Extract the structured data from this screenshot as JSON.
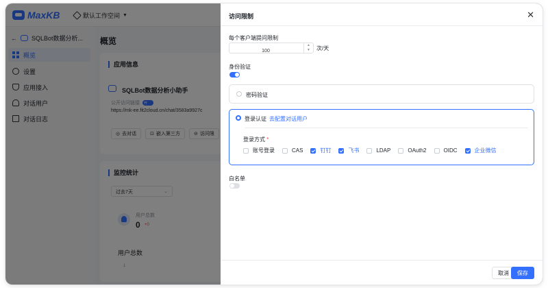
{
  "topbar": {
    "logo": "MaxKB",
    "workspace": "默认工作空间"
  },
  "sidebar": {
    "app_title": "SQLBot数据分析...",
    "items": [
      {
        "label": "概览",
        "icon": "grid-icon",
        "active": true
      },
      {
        "label": "设置",
        "icon": "gear-icon",
        "active": false
      },
      {
        "label": "应用接入",
        "icon": "shield-icon",
        "active": false
      },
      {
        "label": "对话用户",
        "icon": "user-icon",
        "active": false
      },
      {
        "label": "对话日志",
        "icon": "document-icon",
        "active": false
      }
    ]
  },
  "main": {
    "title": "概览",
    "app_info": {
      "heading": "应用信息",
      "app_name": "SQLBot数据分析小助手",
      "public_link_label": "公开访问链接",
      "public_toggle": "开",
      "url": "https://mk-ee.fit2cloud.cn/chat/3583a9927c",
      "buttons": [
        "去对话",
        "嵌入第三方",
        "访问限"
      ]
    },
    "monitor": {
      "heading": "监控统计",
      "range": "过去7天",
      "stat_label": "用户总数",
      "stat_value": "0",
      "stat_delta": "+0",
      "chart_title": "用户总数",
      "axis_tick": "1"
    }
  },
  "drawer": {
    "title": "访问限制",
    "per_client_limit_label": "每个客户端提问限制",
    "per_client_limit_value": "100",
    "per_client_limit_unit": "次/天",
    "auth_label": "身份验证",
    "auth_enabled": true,
    "password_option": "密码验证",
    "login_option": "登录认证",
    "login_link": "去配置对话用户",
    "login_methods_label": "登录方式",
    "required_mark": "*",
    "login_methods": [
      {
        "label": "账号登录",
        "checked": false
      },
      {
        "label": "CAS",
        "checked": false
      },
      {
        "label": "钉钉",
        "checked": true
      },
      {
        "label": "飞书",
        "checked": true
      },
      {
        "label": "LDAP",
        "checked": false
      },
      {
        "label": "OAuth2",
        "checked": false
      },
      {
        "label": "OIDC",
        "checked": false
      },
      {
        "label": "企业微信",
        "checked": true
      }
    ],
    "whitelist_label": "白名单",
    "whitelist_enabled": false,
    "cancel_label": "取消",
    "save_label": "保存"
  },
  "colors": {
    "accent": "#3370ff",
    "danger": "#f54a45",
    "overlay": "rgba(0,0,0,0.5)"
  }
}
